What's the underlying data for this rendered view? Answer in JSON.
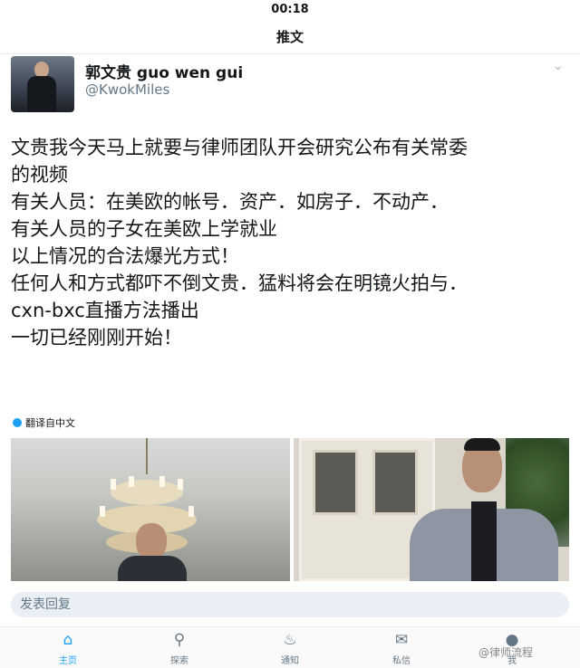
{
  "status_bar": {
    "time": "00:18"
  },
  "nav": {
    "title": "推文"
  },
  "author": {
    "name": "郭文贵 guo wen gui",
    "handle": "@KwokMiles"
  },
  "tweet": {
    "lines": [
      "文贵我今天马上就要与律师团队开会研究公布有关常委",
      "的视频",
      "有关人员：在美欧的帐号．资产．如房子．不动产．",
      "有关人员的子女在美欧上学就业",
      "以上情况的合法爆光方式！",
      "任何人和方式都吓不倒文贵．猛料将会在明镜火拍与．",
      "cxn-bxc直播方法播出",
      "一切已经刚刚开始！"
    ]
  },
  "translate_label": "翻译自中文",
  "reply": {
    "placeholder": "发表回复"
  },
  "tabs": [
    {
      "label": "主页",
      "icon": "home-icon"
    },
    {
      "label": "探索",
      "icon": "search-icon"
    },
    {
      "label": "通知",
      "icon": "bell-icon"
    },
    {
      "label": "私信",
      "icon": "mail-icon"
    },
    {
      "label": "我",
      "icon": "profile-icon"
    }
  ],
  "watermark": "@律师流程",
  "colors": {
    "accent": "#1da1f2",
    "text": "#14171a",
    "muted": "#657786"
  }
}
